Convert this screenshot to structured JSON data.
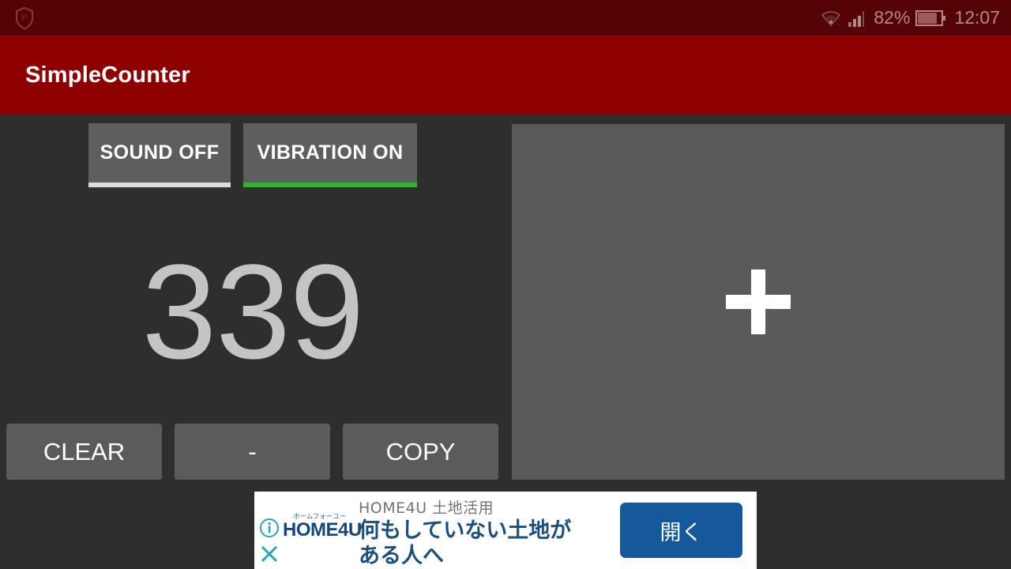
{
  "status_bar": {
    "left_icon": "shield-icon",
    "wifi_icon": "wifi-icon",
    "signal_icon": "signal-bars-icon",
    "battery_percent": "82%",
    "battery_icon": "battery-icon",
    "clock": "12:07",
    "background_color": "#540404",
    "text_color": "#b58787"
  },
  "app_bar": {
    "title": "SimpleCounter",
    "background_color": "#8e0000",
    "title_color": "#ffffff"
  },
  "toggles": {
    "sound": {
      "label": "SOUND OFF",
      "state": "off",
      "underline_color": "#dcdcdc"
    },
    "vibration": {
      "label": "VIBRATION ON",
      "state": "on",
      "underline_color": "#2ab82a"
    }
  },
  "counter": {
    "value": "339",
    "color": "#c4c4c4"
  },
  "increment_panel": {
    "icon": "plus-icon",
    "background_color": "#5a5a5a",
    "icon_color": "#ffffff"
  },
  "actions": [
    {
      "id": "clear",
      "label": "CLEAR"
    },
    {
      "id": "minus",
      "label": "-"
    },
    {
      "id": "copy",
      "label": "COPY"
    }
  ],
  "ad": {
    "info_icon": "info-circle-icon",
    "close_icon": "close-x-icon",
    "logo_kana": "ホームフォーユー",
    "logo_text": "HOME4U",
    "headline": "HOME4U 土地活用",
    "body_line1": "何もしていない土地が",
    "body_line2": "ある人へ",
    "cta_label": "開く",
    "cta_color": "#15599c",
    "body_color": "#1c4f7c",
    "headline_color": "#6e757c"
  }
}
